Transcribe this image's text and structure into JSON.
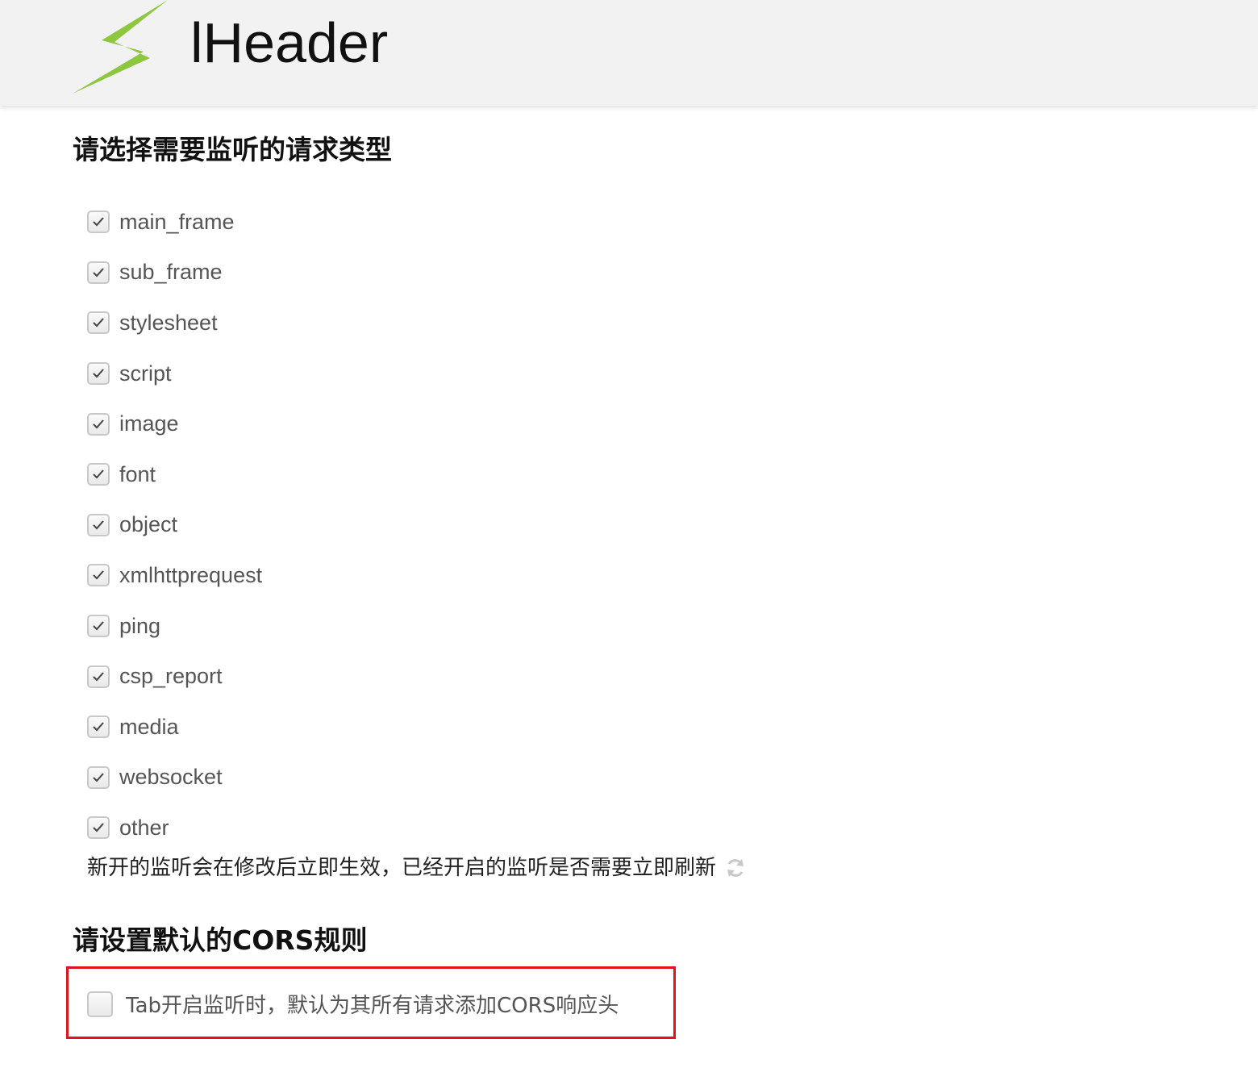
{
  "header": {
    "title": "lHeader",
    "logo_icon": "lightning-bolt-icon",
    "logo_color": "#8dc63f"
  },
  "section1": {
    "title": "请选择需要监听的请求类型",
    "items": [
      {
        "label": "main_frame",
        "checked": true
      },
      {
        "label": "sub_frame",
        "checked": true
      },
      {
        "label": "stylesheet",
        "checked": true
      },
      {
        "label": "script",
        "checked": true
      },
      {
        "label": "image",
        "checked": true
      },
      {
        "label": "font",
        "checked": true
      },
      {
        "label": "object",
        "checked": true
      },
      {
        "label": "xmlhttprequest",
        "checked": true
      },
      {
        "label": "ping",
        "checked": true
      },
      {
        "label": "csp_report",
        "checked": true
      },
      {
        "label": "media",
        "checked": true
      },
      {
        "label": "websocket",
        "checked": true
      },
      {
        "label": "other",
        "checked": true
      }
    ],
    "note": "新开的监听会在修改后立即生效，已经开启的监听是否需要立即刷新",
    "refresh_icon": "refresh-icon"
  },
  "section2": {
    "title": "请设置默认的CORS规则",
    "option": {
      "label": "Tab开启监听时，默认为其所有请求添加CORS响应头",
      "checked": false
    },
    "highlight_color": "#e0141c"
  }
}
